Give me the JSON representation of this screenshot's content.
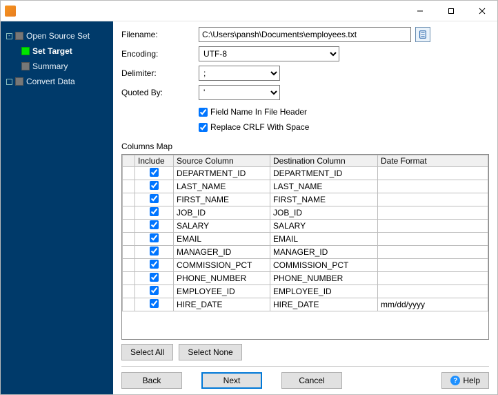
{
  "titlebar": {
    "minimize": "",
    "maximize": "",
    "close": ""
  },
  "sidebar": {
    "items": [
      {
        "label": "Open Source Set",
        "active": false,
        "child": false,
        "toggle": "-"
      },
      {
        "label": "Set Target",
        "active": true,
        "child": true,
        "bold": true
      },
      {
        "label": "Summary",
        "active": false,
        "child": true
      },
      {
        "label": "Convert Data",
        "active": false,
        "child": false
      }
    ]
  },
  "form": {
    "filename_label": "Filename:",
    "filename_value": "C:\\Users\\pansh\\Documents\\employees.txt",
    "encoding_label": "Encoding:",
    "encoding_value": "UTF-8",
    "delimiter_label": "Delimiter:",
    "delimiter_value": ";",
    "quoted_label": "Quoted By:",
    "quoted_value": "'",
    "fieldname_header_label": "Field Name In File Header",
    "fieldname_header_checked": true,
    "replace_crlf_label": "Replace CRLF With Space",
    "replace_crlf_checked": true
  },
  "columns_map": {
    "title": "Columns Map",
    "headers": {
      "include": "Include",
      "source": "Source Column",
      "destination": "Destination Column",
      "dateformat": "Date Format"
    },
    "rows": [
      {
        "include": true,
        "source": "DEPARTMENT_ID",
        "dest": "DEPARTMENT_ID",
        "dateformat": ""
      },
      {
        "include": true,
        "source": "LAST_NAME",
        "dest": "LAST_NAME",
        "dateformat": ""
      },
      {
        "include": true,
        "source": "FIRST_NAME",
        "dest": "FIRST_NAME",
        "dateformat": ""
      },
      {
        "include": true,
        "source": "JOB_ID",
        "dest": "JOB_ID",
        "dateformat": ""
      },
      {
        "include": true,
        "source": "SALARY",
        "dest": "SALARY",
        "dateformat": ""
      },
      {
        "include": true,
        "source": "EMAIL",
        "dest": "EMAIL",
        "dateformat": ""
      },
      {
        "include": true,
        "source": "MANAGER_ID",
        "dest": "MANAGER_ID",
        "dateformat": ""
      },
      {
        "include": true,
        "source": "COMMISSION_PCT",
        "dest": "COMMISSION_PCT",
        "dateformat": ""
      },
      {
        "include": true,
        "source": "PHONE_NUMBER",
        "dest": "PHONE_NUMBER",
        "dateformat": ""
      },
      {
        "include": true,
        "source": "EMPLOYEE_ID",
        "dest": "EMPLOYEE_ID",
        "dateformat": ""
      },
      {
        "include": true,
        "source": "HIRE_DATE",
        "dest": "HIRE_DATE",
        "dateformat": "mm/dd/yyyy"
      }
    ],
    "select_all_label": "Select All",
    "select_none_label": "Select None"
  },
  "footer": {
    "back": "Back",
    "next": "Next",
    "cancel": "Cancel",
    "help": "Help"
  }
}
